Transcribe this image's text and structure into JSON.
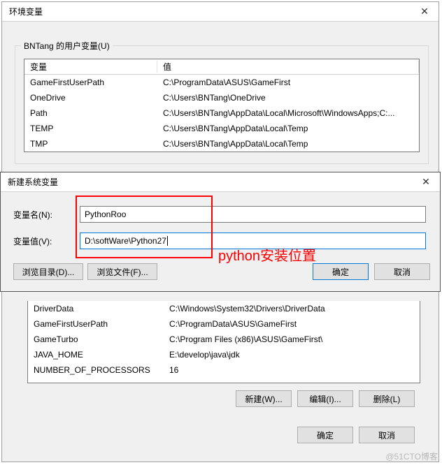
{
  "env_window": {
    "title": "环境变量",
    "user_group_label": "BNTang 的用户变量(U)",
    "columns": {
      "var": "变量",
      "val": "值"
    },
    "user_rows": [
      {
        "var": "GameFirstUserPath",
        "val": "C:\\ProgramData\\ASUS\\GameFirst"
      },
      {
        "var": "OneDrive",
        "val": "C:\\Users\\BNTang\\OneDrive"
      },
      {
        "var": "Path",
        "val": "C:\\Users\\BNTang\\AppData\\Local\\Microsoft\\WindowsApps;C:..."
      },
      {
        "var": "TEMP",
        "val": "C:\\Users\\BNTang\\AppData\\Local\\Temp"
      },
      {
        "var": "TMP",
        "val": "C:\\Users\\BNTang\\AppData\\Local\\Temp"
      }
    ],
    "sys_rows": [
      {
        "var": "DriverData",
        "val": "C:\\Windows\\System32\\Drivers\\DriverData"
      },
      {
        "var": "GameFirstUserPath",
        "val": "C:\\ProgramData\\ASUS\\GameFirst"
      },
      {
        "var": "GameTurbo",
        "val": "C:\\Program Files (x86)\\ASUS\\GameFirst\\"
      },
      {
        "var": "JAVA_HOME",
        "val": "E:\\develop\\java\\jdk"
      },
      {
        "var": "NUMBER_OF_PROCESSORS",
        "val": "16"
      }
    ],
    "sys_buttons": {
      "new": "新建(W)...",
      "edit": "编辑(I)...",
      "del": "删除(L)"
    },
    "main_buttons": {
      "ok": "确定",
      "cancel": "取消"
    }
  },
  "new_var_dialog": {
    "title": "新建系统变量",
    "name_label": "变量名(N):",
    "value_label": "变量值(V):",
    "name_value": "PythonRoo",
    "value_value": "D:\\softWare\\Python27",
    "browse_dir": "浏览目录(D)...",
    "browse_file": "浏览文件(F)...",
    "ok": "确定",
    "cancel": "取消"
  },
  "annotation": "python安装位置",
  "watermark": "@51CTO博客"
}
